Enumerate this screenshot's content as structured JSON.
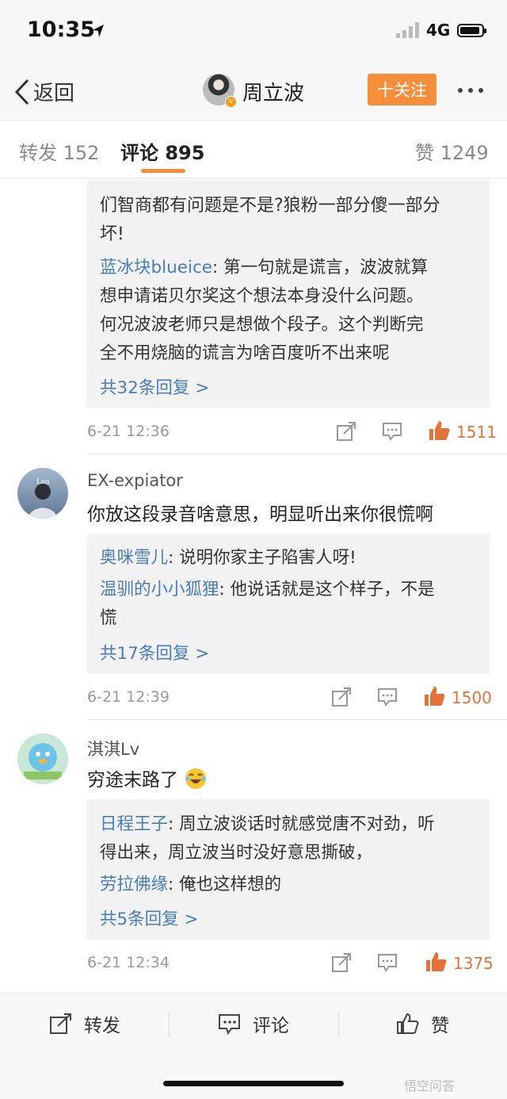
{
  "status_bar": {
    "time": "10:35",
    "network": "4G"
  },
  "nav": {
    "back_label": "返回",
    "title": "周立波",
    "follow_label": "十关注"
  },
  "tabs": {
    "repost": "转发 152",
    "comments": "评论 895",
    "likes": "赞 1249"
  },
  "comments": [
    {
      "partial_text_line1": "们智商都有问题是不是?狼粉一部分傻一部分",
      "partial_text_line2": "坏!",
      "replies": [
        {
          "user": "蓝冰块blueice",
          "text_line1": "第一句就是谎言，波波就算",
          "text_line2": "想申请诺贝尔奖这个想法本身没什么问题。",
          "text_line3": "何况波波老师只是想做个段子。这个判断完",
          "text_line4": "全不用烧脑的谎言为啥百度听不出来呢"
        }
      ],
      "more_replies": "共32条回复 >",
      "time": "6-21 12:36",
      "likes": "1511"
    },
    {
      "user": "EX-expiator",
      "text": "你放这段录音啥意思，明显听出来你很慌啊",
      "replies": [
        {
          "user": "奥咪雪儿",
          "text_line1": "说明你家主子陷害人呀!"
        },
        {
          "user": "温驯的小小狐狸",
          "text_line1": "他说话就是这个样子，不是",
          "text_line2": "慌"
        }
      ],
      "more_replies": "共17条回复 >",
      "time": "6-21 12:39",
      "likes": "1500"
    },
    {
      "user": "淇淇Lv",
      "text": "穷途末路了",
      "replies": [
        {
          "user": "日程王子",
          "text_line1": "周立波谈话时就感觉唐不对劲，听",
          "text_line2": "得出来，周立波当时没好意思撕破，"
        },
        {
          "user": "劳拉佛缘",
          "text_line1": "俺也这样想的"
        }
      ],
      "more_replies": "共5条回复 >",
      "time": "6-21 12:34",
      "likes": "1375"
    }
  ],
  "bottom_bar": {
    "repost": "转发",
    "comment": "评论",
    "like": "赞"
  },
  "watermark": "悟空问答",
  "colors": {
    "accent": "#f78e3c",
    "link": "#4a7cb8",
    "like": "#e2743b"
  }
}
